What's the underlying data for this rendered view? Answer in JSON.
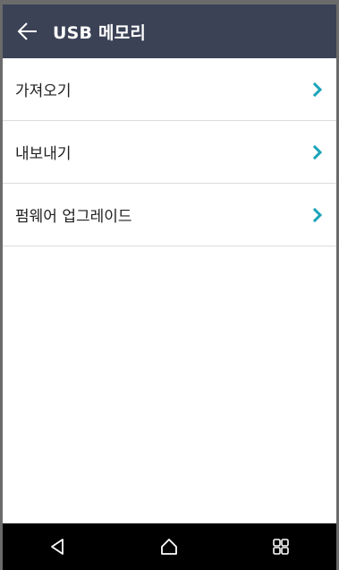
{
  "header": {
    "title": "USB 메모리",
    "back_icon": "arrow-left-icon",
    "background": "#3b4256"
  },
  "menu": {
    "items": [
      {
        "label": "가져오기",
        "icon": "chevron-right-icon"
      },
      {
        "label": "내보내기",
        "icon": "chevron-right-icon"
      },
      {
        "label": "펌웨어 업그레이드",
        "icon": "chevron-right-icon"
      }
    ],
    "chevron_color": "#1aa3b8"
  },
  "navigation": {
    "buttons": [
      {
        "icon": "back-triangle-icon"
      },
      {
        "icon": "home-icon"
      },
      {
        "icon": "recent-apps-icon"
      }
    ]
  }
}
